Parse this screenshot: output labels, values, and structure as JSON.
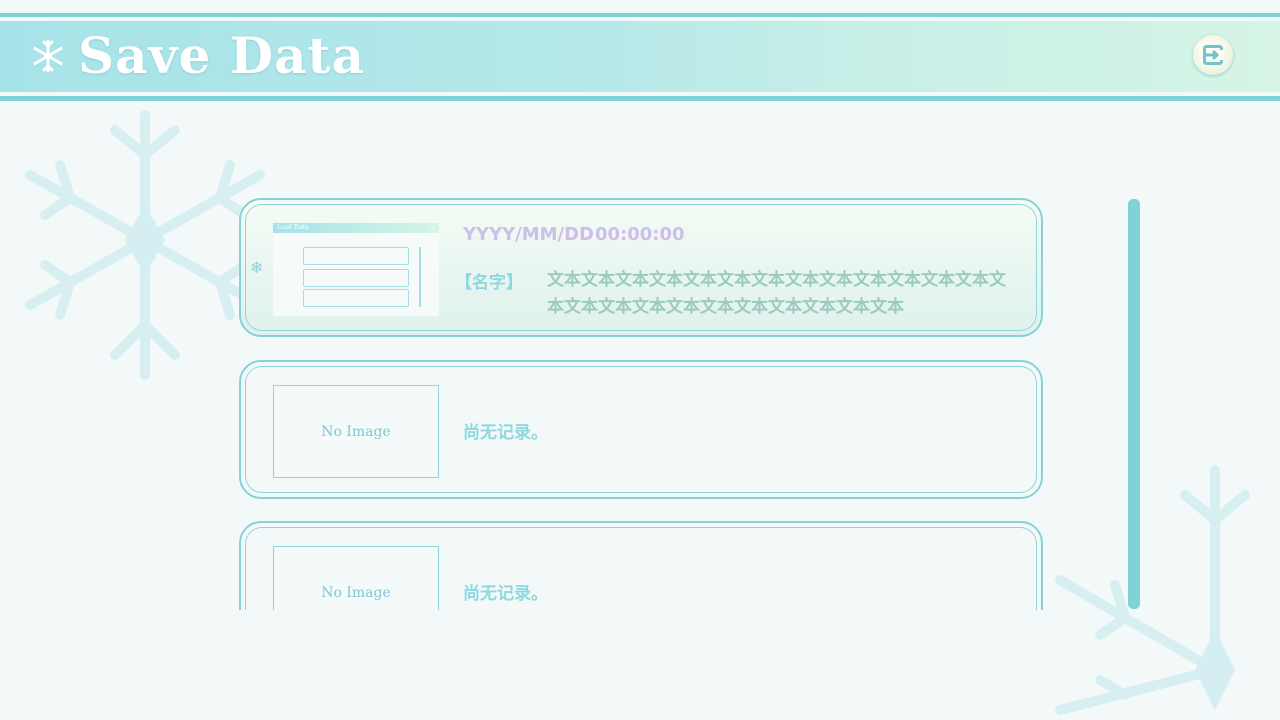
{
  "header": {
    "title": "Save Data",
    "snowflake_icon": "snowflake-icon",
    "exit_icon": "exit-icon"
  },
  "slots": [
    {
      "date": "YYYY/MM/DD",
      "time": "00:00:00",
      "name": "【名字】",
      "text": "文本文本文本文本文本文本文本文本文本文本文本文本文本文本文本文本文本文本文本文本文本文本文本文本",
      "thumbnail_title": "Load Data",
      "thumbnail_close": "×"
    },
    {
      "no_image": "No Image",
      "empty_label": "尚无记录。"
    },
    {
      "no_image": "No Image",
      "empty_label": "尚无记录。"
    }
  ],
  "colors": {
    "accent": "#7fd3d8",
    "header_start": "#a6e3e8",
    "header_end": "#d6f5e6",
    "date_text": "#cdbfe8",
    "body_text": "#9bcbbf",
    "background": "#f3f9f9"
  }
}
